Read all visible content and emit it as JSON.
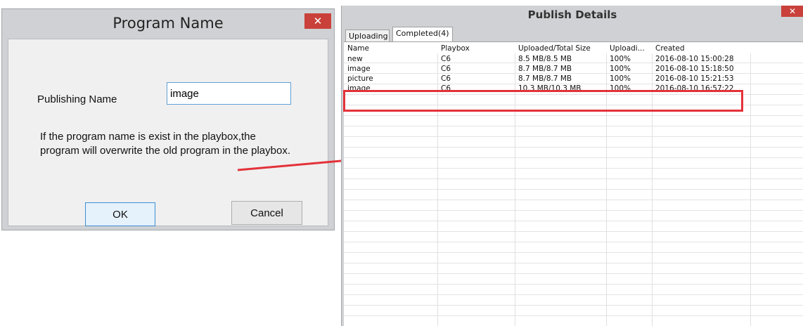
{
  "program_dialog": {
    "title": "Program Name",
    "close_label": "✕",
    "publishing_name_label": "Publishing Name",
    "publishing_name_value": "image",
    "warning_line1": "If the program name is exist in the playbox,the",
    "warning_line2": "program will overwrite the old program in the  playbox.",
    "ok_label": "OK",
    "cancel_label": "Cancel"
  },
  "publish_window": {
    "title": "Publish Details",
    "close_label": "✕",
    "tabs": [
      {
        "label": "Uploading"
      },
      {
        "label": "Completed(4)"
      }
    ],
    "columns": [
      "Name",
      "Playbox",
      "Uploaded/Total Size",
      "Uploadi...",
      "Created"
    ],
    "rows": [
      {
        "name": "new",
        "playbox": "C6",
        "size": "8.5 MB/8.5 MB",
        "progress": "100%",
        "created": "2016-08-10 15:00:28"
      },
      {
        "name": "image",
        "playbox": "C6",
        "size": "8.7 MB/8.7 MB",
        "progress": "100%",
        "created": "2016-08-10 15:18:50"
      },
      {
        "name": "picture",
        "playbox": "C6",
        "size": "8.7 MB/8.7 MB",
        "progress": "100%",
        "created": "2016-08-10 15:21:53"
      },
      {
        "name": "image",
        "playbox": "C6",
        "size": "10.3 MB/10.3 MB",
        "progress": "100%",
        "created": "2016-08-10 16:57:22"
      }
    ]
  },
  "colors": {
    "close_button": "#c9413a",
    "annotation_red": "#e3323a",
    "selected_button_border": "#3d8ed6"
  }
}
